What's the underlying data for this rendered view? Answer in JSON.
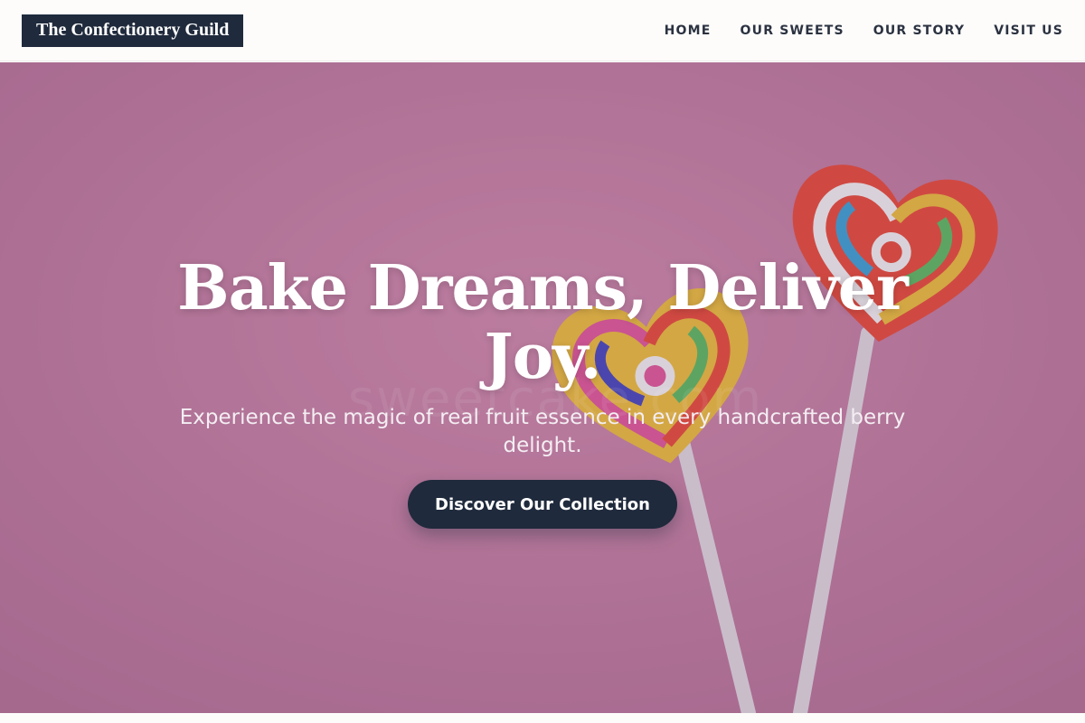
{
  "brand": {
    "name": "The Confectionery Guild"
  },
  "nav": {
    "items": [
      {
        "label": "HOME"
      },
      {
        "label": "OUR SWEETS"
      },
      {
        "label": "OUR STORY"
      },
      {
        "label": "VISIT US"
      }
    ]
  },
  "hero": {
    "title_line1": "Bake Dreams, Deliver",
    "title_line2": "Joy.",
    "subtitle": "Experience the magic of real fruit essence in every handcrafted berry delight.",
    "cta_label": "Discover Our Collection",
    "watermark": "sweetcake.com",
    "image": "heart-shaped-lollipops-on-pink-background"
  },
  "colors": {
    "brand_dark": "#1f2a3c",
    "hero_pink": "#c47aa1",
    "nav_text": "#2b3240"
  }
}
